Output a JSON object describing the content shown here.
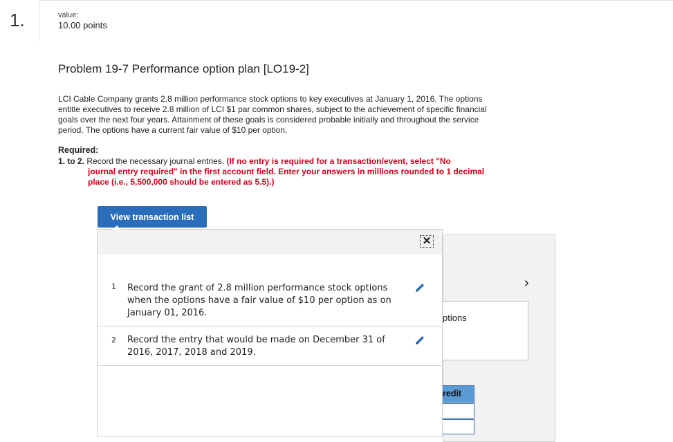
{
  "question": {
    "number": "1.",
    "value_label": "value:",
    "points": "10.00 points"
  },
  "problem": {
    "title": "Problem 19-7 Performance option plan [LO19-2]",
    "text": "LCI Cable Company grants 2.8 million performance stock options to key executives at January 1, 2016. The options entitle executives to receive 2.8 million of LCI $1 par common shares, subject to the achievement of specific financial goals over the next four years. Attainment of these goals is considered probable initially and throughout the service period. The options have a current fair value of $10 per option."
  },
  "required": {
    "label": "Required:",
    "range": "1. to 2.",
    "instruction": " Record the necessary journal entries. ",
    "note_start": "(If no entry is required for a transaction/event, select \"No",
    "note_rest": "journal entry required\" in the first account field. Enter your answers in millions rounded to 1 decimal place (i.e., 5,500,000 should be entered as 5.5).)"
  },
  "view_button": {
    "label": "View transaction list"
  },
  "transactions": [
    {
      "number": "1",
      "text": "Record the grant of 2.8 million performance stock options when the options have a fair value of $10 per option as on January 01, 2016."
    },
    {
      "number": "2",
      "text": "Record the entry that would be made on December 31 of 2016, 2017, 2018 and 2019."
    }
  ],
  "background": {
    "field_text": "ptions",
    "credit_label": "redit",
    "next_glyph": "›"
  },
  "icons": {
    "close": "close-icon",
    "edit": "pencil-icon",
    "next": "chevron-right-icon"
  },
  "colors": {
    "primary": "#2a6ebb",
    "warning": "#d0021b",
    "credit_header": "#5b9bd5"
  }
}
